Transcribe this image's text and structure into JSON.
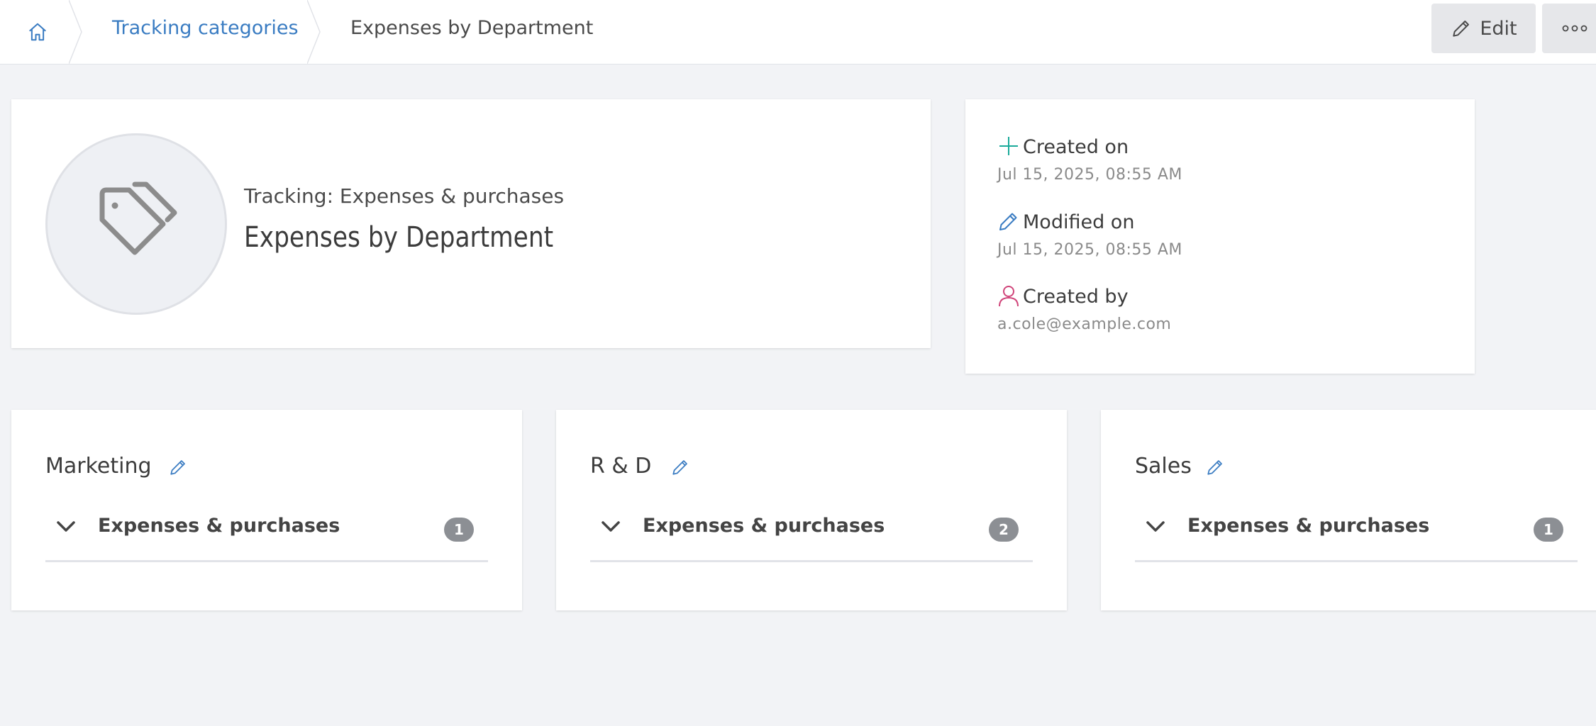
{
  "breadcrumb": {
    "home_icon": "home-icon",
    "items": [
      {
        "label": "Tracking categories"
      },
      {
        "label": "Expenses by Department"
      }
    ]
  },
  "toolbar": {
    "edit_label": "Edit",
    "edit_icon": "pencil-icon",
    "more_icon": "more-dots-icon"
  },
  "hero": {
    "icon": "tag-icon",
    "subtitle": "Tracking: Expenses & purchases",
    "title": "Expenses by Department"
  },
  "meta": {
    "created_on": {
      "label": "Created on",
      "value": "Jul 15, 2025, 08:55 AM",
      "icon": "plus-icon",
      "color": "#1aaa9a"
    },
    "modified_on": {
      "label": "Modified on",
      "value": "Jul 15, 2025, 08:55 AM",
      "icon": "pencil-icon",
      "color": "#3a7cc2"
    },
    "created_by": {
      "label": "Created by",
      "value": "a.cole@example.com",
      "icon": "user-icon",
      "color": "#d0457a"
    }
  },
  "departments": [
    {
      "name": "Marketing",
      "section": "Expenses & purchases",
      "count": "1"
    },
    {
      "name": "R & D",
      "section": "Expenses & purchases",
      "count": "2"
    },
    {
      "name": "Sales",
      "section": "Expenses & purchases",
      "count": "1"
    }
  ],
  "colors": {
    "link": "#3a7cc2",
    "background": "#f2f3f6",
    "badge": "#8c8f94"
  }
}
